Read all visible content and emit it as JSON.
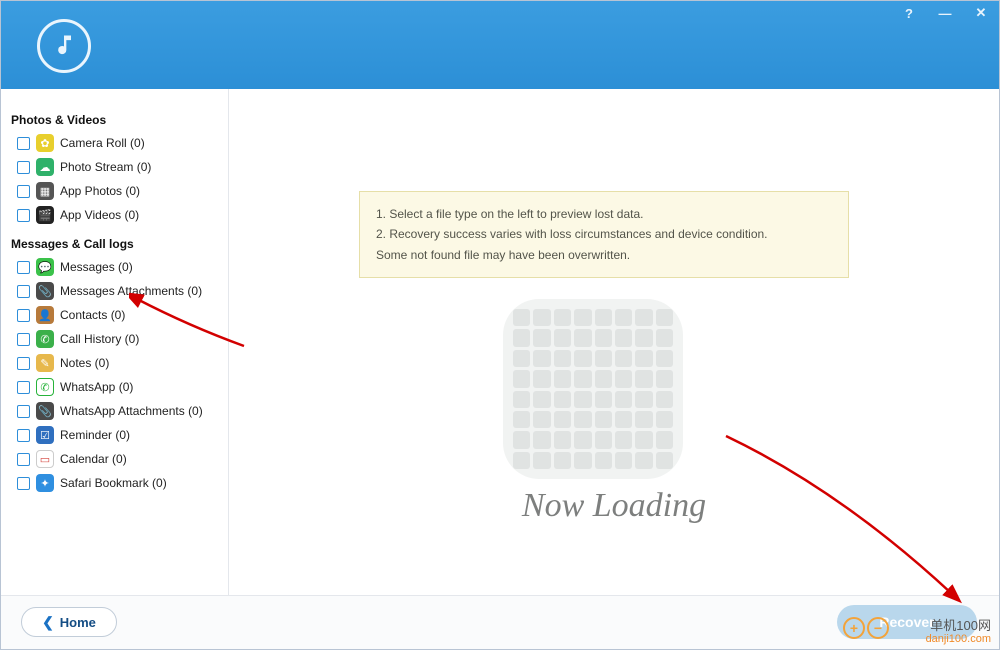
{
  "titlebar": {
    "help": "?",
    "minimize": "—",
    "close": "✕"
  },
  "sidebar": {
    "sections": [
      {
        "title": "Photos & Videos",
        "items": [
          {
            "name": "camera-roll",
            "label": "Camera Roll (0)",
            "icon_bg": "#e8cf2d",
            "glyph": "✿"
          },
          {
            "name": "photo-stream",
            "label": "Photo Stream (0)",
            "icon_bg": "#2fb16a",
            "glyph": "☁"
          },
          {
            "name": "app-photos",
            "label": "App Photos (0)",
            "icon_bg": "#555555",
            "glyph": "▦"
          },
          {
            "name": "app-videos",
            "label": "App Videos (0)",
            "icon_bg": "#222222",
            "glyph": "🎬"
          }
        ]
      },
      {
        "title": "Messages & Call logs",
        "items": [
          {
            "name": "messages",
            "label": "Messages (0)",
            "icon_bg": "#3bc24a",
            "glyph": "💬"
          },
          {
            "name": "messages-attachments",
            "label": "Messages Attachments (0)",
            "icon_bg": "#4a4a4a",
            "glyph": "📎"
          },
          {
            "name": "contacts",
            "label": "Contacts (0)",
            "icon_bg": "#b77a3b",
            "glyph": "👤"
          },
          {
            "name": "call-history",
            "label": "Call History (0)",
            "icon_bg": "#3bb04a",
            "glyph": "✆"
          },
          {
            "name": "notes",
            "label": "Notes (0)",
            "icon_bg": "#e7b84c",
            "glyph": "✎"
          },
          {
            "name": "whatsapp",
            "label": "WhatsApp (0)",
            "icon_bg": "#ffffff",
            "glyph": "✆",
            "fg": "#27b33a",
            "border": "1px solid #27b33a"
          },
          {
            "name": "whatsapp-attachments",
            "label": "WhatsApp Attachments (0)",
            "icon_bg": "#4a4a4a",
            "glyph": "📎"
          },
          {
            "name": "reminder",
            "label": "Reminder (0)",
            "icon_bg": "#2f6fbf",
            "glyph": "☑"
          },
          {
            "name": "calendar",
            "label": "Calendar (0)",
            "icon_bg": "#ffffff",
            "glyph": "▭",
            "fg": "#d4403a",
            "border": "1px solid #ccc"
          },
          {
            "name": "safari-bookmark",
            "label": "Safari Bookmark (0)",
            "icon_bg": "#2f8fe0",
            "glyph": "✦"
          }
        ]
      }
    ]
  },
  "main": {
    "info_line1": "1. Select a file type on the left to preview lost data.",
    "info_line2": "2. Recovery success varies with loss circumstances and device condition.",
    "info_line3": "Some not found file may have been overwritten.",
    "loading_text": "Now Loading"
  },
  "footer": {
    "home_label": "Home",
    "recover_label": "Recover"
  },
  "watermark": {
    "title": "单机100网",
    "domain": "danji100.com"
  }
}
